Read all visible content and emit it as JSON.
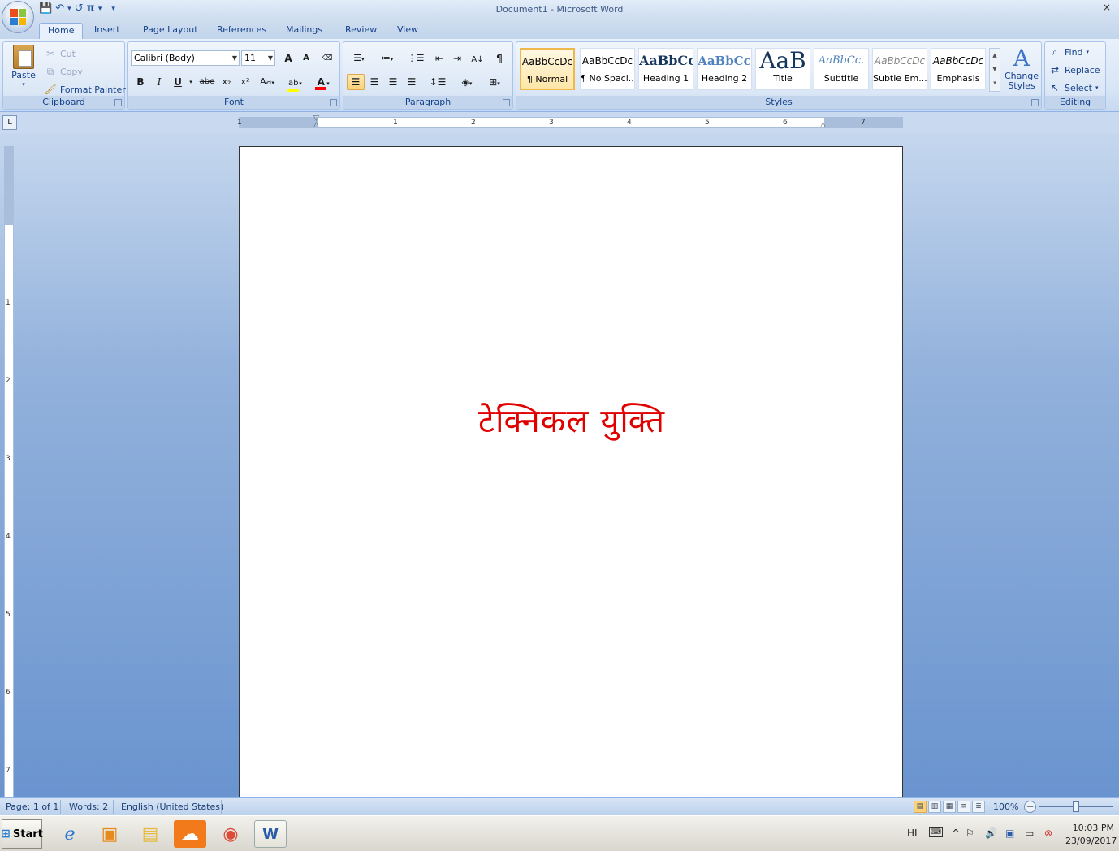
{
  "window": {
    "title": "Document1 - Microsoft Word",
    "close": "×"
  },
  "qat": {
    "save": "💾",
    "undo": "↶",
    "undo_dd": "▾",
    "redo": "↺",
    "pi": "π",
    "pi_dd": "▾",
    "customize": "▾"
  },
  "tabs": [
    "Home",
    "Insert",
    "Page Layout",
    "References",
    "Mailings",
    "Review",
    "View"
  ],
  "clipboard": {
    "paste": "Paste",
    "cut": "Cut",
    "copy": "Copy",
    "format_painter": "Format Painter",
    "label": "Clipboard"
  },
  "font": {
    "name": "Calibri (Body)",
    "size": "11",
    "label": "Font",
    "bold": "B",
    "italic": "I",
    "underline": "U",
    "strike": "abe",
    "sub": "x₂",
    "sup": "x²",
    "case": "Aa",
    "grow": "A",
    "shrink": "A"
  },
  "paragraph": {
    "label": "Paragraph",
    "pilcrow": "¶"
  },
  "styles": {
    "label": "Styles",
    "tiles": [
      {
        "preview": "AaBbCcDc",
        "name": "¶ Normal"
      },
      {
        "preview": "AaBbCcDc",
        "name": "¶ No Spaci..."
      },
      {
        "preview": "AaBbCc",
        "name": "Heading 1"
      },
      {
        "preview": "AaBbCc",
        "name": "Heading 2"
      },
      {
        "preview": "AaB",
        "name": "Title"
      },
      {
        "preview": "AaBbCc.",
        "name": "Subtitle"
      },
      {
        "preview": "AaBbCcDc",
        "name": "Subtle Em..."
      },
      {
        "preview": "AaBbCcDc",
        "name": "Emphasis"
      }
    ],
    "change_styles_1": "Change",
    "change_styles_2": "Styles"
  },
  "editing": {
    "find": "Find",
    "replace": "Replace",
    "select": "Select",
    "label": "Editing"
  },
  "ruler": {
    "tab_selector": "L",
    "numbers": [
      "1",
      "1",
      "2",
      "3",
      "4",
      "5",
      "6",
      "7"
    ],
    "vnumbers": [
      "1",
      "2",
      "3",
      "4",
      "5",
      "6",
      "7"
    ]
  },
  "document": {
    "text": "टेक्निकल युक्ति",
    "text_color": "#e00000"
  },
  "status": {
    "page": "Page: 1 of 1",
    "words": "Words: 2",
    "language": "English (United States)",
    "zoom": "100%"
  },
  "taskbar": {
    "start": "Start",
    "lang": "HI",
    "time": "10:03 PM",
    "date": "23/09/2017"
  }
}
